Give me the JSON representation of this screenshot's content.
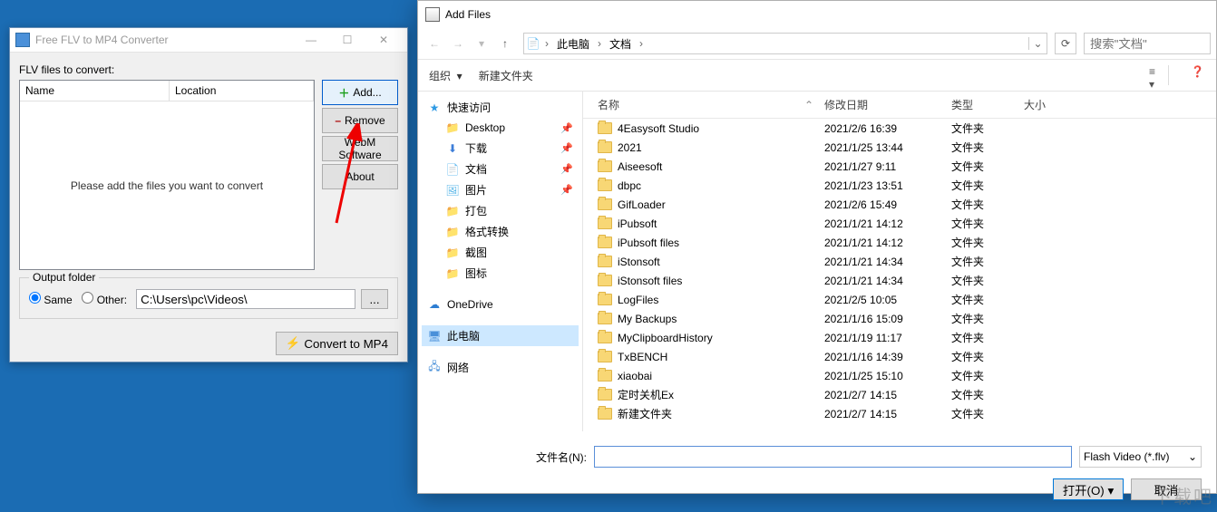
{
  "converter": {
    "title": "Free FLV to MP4 Converter",
    "files_label": "FLV files to convert:",
    "col_name": "Name",
    "col_location": "Location",
    "empty_msg": "Please add the files you want to convert",
    "btn_add": "Add...",
    "btn_remove": "Remove",
    "btn_webm": "WebM Software",
    "btn_about": "About",
    "output_legend": "Output folder",
    "radio_same": "Same",
    "radio_other": "Other:",
    "path_value": "C:\\Users\\pc\\Videos\\",
    "browse_label": "...",
    "convert_label": "Convert to MP4"
  },
  "dialog": {
    "title": "Add Files",
    "crumb1": "此电脑",
    "crumb2": "文档",
    "search_placeholder": "搜索\"文档\"",
    "tb_organize": "组织",
    "tb_newfolder": "新建文件夹",
    "tree": {
      "quick": "快速访问",
      "quick_items": [
        {
          "icon": "fold",
          "label": "Desktop",
          "pin": true
        },
        {
          "icon": "dl",
          "label": "下载",
          "pin": true
        },
        {
          "icon": "doc",
          "label": "文档",
          "pin": true
        },
        {
          "icon": "pic",
          "label": "图片",
          "pin": true
        },
        {
          "icon": "fold",
          "label": "打包",
          "pin": false
        },
        {
          "icon": "fold",
          "label": "格式转换",
          "pin": false
        },
        {
          "icon": "fold",
          "label": "截图",
          "pin": false
        },
        {
          "icon": "fold",
          "label": "图标",
          "pin": false
        }
      ],
      "onedrive": "OneDrive",
      "thispc": "此电脑",
      "network": "网络"
    },
    "columns": {
      "name": "名称",
      "date": "修改日期",
      "type": "类型",
      "size": "大小"
    },
    "rows": [
      {
        "name": "4Easysoft Studio",
        "date": "2021/2/6 16:39",
        "type": "文件夹"
      },
      {
        "name": "2021",
        "date": "2021/1/25 13:44",
        "type": "文件夹"
      },
      {
        "name": "Aiseesoft",
        "date": "2021/1/27 9:11",
        "type": "文件夹"
      },
      {
        "name": "dbpc",
        "date": "2021/1/23 13:51",
        "type": "文件夹"
      },
      {
        "name": "GifLoader",
        "date": "2021/2/6 15:49",
        "type": "文件夹"
      },
      {
        "name": "iPubsoft",
        "date": "2021/1/21 14:12",
        "type": "文件夹"
      },
      {
        "name": "iPubsoft files",
        "date": "2021/1/21 14:12",
        "type": "文件夹"
      },
      {
        "name": "iStonsoft",
        "date": "2021/1/21 14:34",
        "type": "文件夹"
      },
      {
        "name": "iStonsoft files",
        "date": "2021/1/21 14:34",
        "type": "文件夹"
      },
      {
        "name": "LogFiles",
        "date": "2021/2/5 10:05",
        "type": "文件夹"
      },
      {
        "name": "My Backups",
        "date": "2021/1/16 15:09",
        "type": "文件夹"
      },
      {
        "name": "MyClipboardHistory",
        "date": "2021/1/19 11:17",
        "type": "文件夹"
      },
      {
        "name": "TxBENCH",
        "date": "2021/1/16 14:39",
        "type": "文件夹"
      },
      {
        "name": "xiaobai",
        "date": "2021/1/25 15:10",
        "type": "文件夹"
      },
      {
        "name": "定时关机Ex",
        "date": "2021/2/7 14:15",
        "type": "文件夹"
      },
      {
        "name": "新建文件夹",
        "date": "2021/2/7 14:15",
        "type": "文件夹"
      }
    ],
    "filename_label": "文件名(N):",
    "filetype_label": "Flash Video (*.flv)",
    "btn_open": "打开(O)",
    "btn_cancel": "取消"
  },
  "watermark": "下载吧"
}
